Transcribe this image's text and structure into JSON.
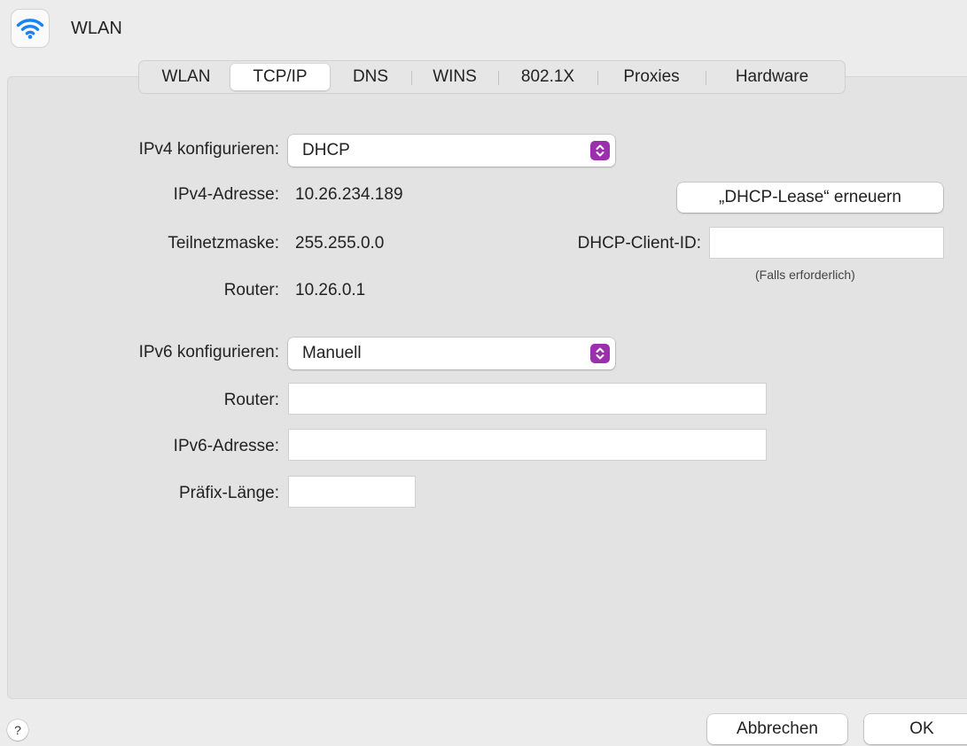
{
  "header": {
    "title": "WLAN",
    "icon": "wifi-icon"
  },
  "tabs": [
    "WLAN",
    "TCP/IP",
    "DNS",
    "WINS",
    "802.1X",
    "Proxies",
    "Hardware"
  ],
  "active_tab": "TCP/IP",
  "ipv4": {
    "configure_label": "IPv4 konfigurieren:",
    "configure_value": "DHCP",
    "address_label": "IPv4-Adresse:",
    "address_value": "10.26.234.189",
    "subnet_label": "Teilnetzmaske:",
    "subnet_value": "255.255.0.0",
    "router_label": "Router:",
    "router_value": "10.26.0.1"
  },
  "dhcp": {
    "renew_button": "„DHCP-Lease“ erneuern",
    "client_id_label": "DHCP-Client-ID:",
    "client_id_value": "",
    "client_id_hint": "(Falls erforderlich)"
  },
  "ipv6": {
    "configure_label": "IPv6 konfigurieren:",
    "configure_value": "Manuell",
    "router_label": "Router:",
    "router_value": "",
    "address_label": "IPv6-Adresse:",
    "address_value": "",
    "prefix_label": "Präfix-Länge:",
    "prefix_value": ""
  },
  "footer": {
    "help_label": "?",
    "cancel_label": "Abbrechen",
    "ok_label": "OK"
  },
  "colors": {
    "accent": "#9b2fae",
    "wifi": "#1a82f5",
    "panel": "#e3e3e3",
    "window": "#ececec"
  }
}
